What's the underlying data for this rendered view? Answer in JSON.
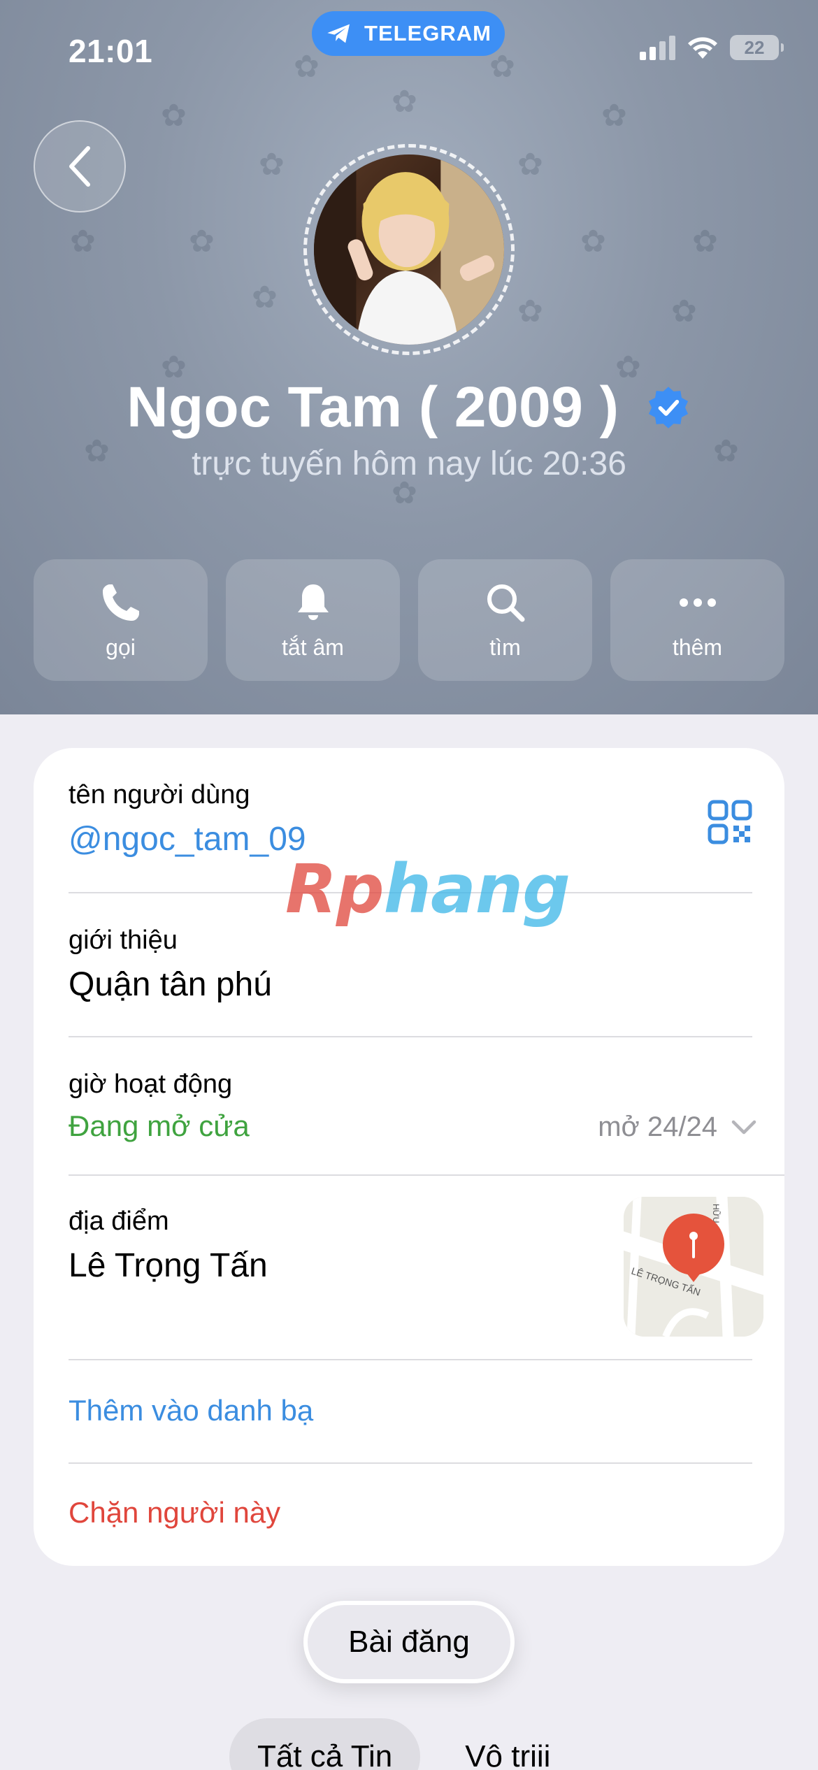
{
  "status_bar": {
    "time": "21:01",
    "battery": "22"
  },
  "app_pill": {
    "label": "TELEGRAM"
  },
  "profile": {
    "name": "Ngoc Tam ( 2009 )",
    "status": "trực tuyến hôm nay lúc 20:36"
  },
  "actions": [
    {
      "label": "gọi",
      "icon": "phone-icon"
    },
    {
      "label": "tắt âm",
      "icon": "bell-icon"
    },
    {
      "label": "tìm",
      "icon": "search-icon"
    },
    {
      "label": "thêm",
      "icon": "more-icon"
    }
  ],
  "info": {
    "username_label": "tên người dùng",
    "username_value": "@ngoc_tam_09",
    "bio_label": "giới thiệu",
    "bio_value": "Quận tân phú",
    "hours_label": "giờ hoạt động",
    "hours_status": "Đang mở cửa",
    "hours_detail": "mở 24/24",
    "location_label": "địa điểm",
    "location_value": "Lê Trọng Tấn",
    "map_street": "LÊ TRỌNG TẤN",
    "map_street_2": "HỮU",
    "add_contact": "Thêm vào danh bạ",
    "block": "Chặn người này"
  },
  "watermark": {
    "part1": "Rp",
    "part2": "hang"
  },
  "posts_button": "Bài đăng",
  "tabs": [
    {
      "label": "Tất cả Tin",
      "active": true
    },
    {
      "label": "Vô triii",
      "active": false
    }
  ],
  "colors": {
    "accent_blue": "#3b8de0",
    "open_green": "#3fa33f",
    "danger_red": "#e0463c",
    "telegram_blue": "#3d8ff5"
  }
}
